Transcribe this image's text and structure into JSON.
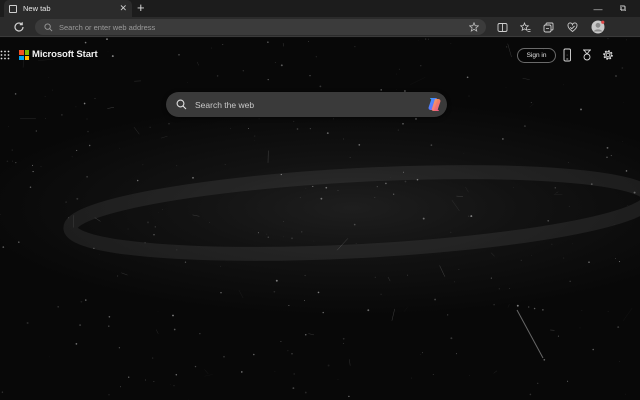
{
  "tab": {
    "title": "New tab",
    "close": "✕"
  },
  "new_tab_glyph": "+",
  "window": {
    "minimize": "—",
    "restore": "⧉"
  },
  "addressbar": {
    "placeholder": "Search or enter web address"
  },
  "page": {
    "brand": "Microsoft Start",
    "sign_in": "Sign in",
    "search_placeholder": "Search the web"
  },
  "colors": {
    "logo_red": "#f25022",
    "logo_green": "#7fba00",
    "logo_blue": "#00a4ef",
    "logo_yellow": "#ffb900"
  },
  "icons": [
    "page-icon",
    "refresh-icon",
    "favorite-star-icon",
    "split-screen-icon",
    "favorites-icon",
    "collections-icon",
    "browser-essentials-icon",
    "profile-avatar-icon",
    "apps-grid-icon",
    "microsoft-logo-icon",
    "phone-icon",
    "rewards-icon",
    "settings-gear-icon",
    "search-icon",
    "copilot-icon"
  ]
}
